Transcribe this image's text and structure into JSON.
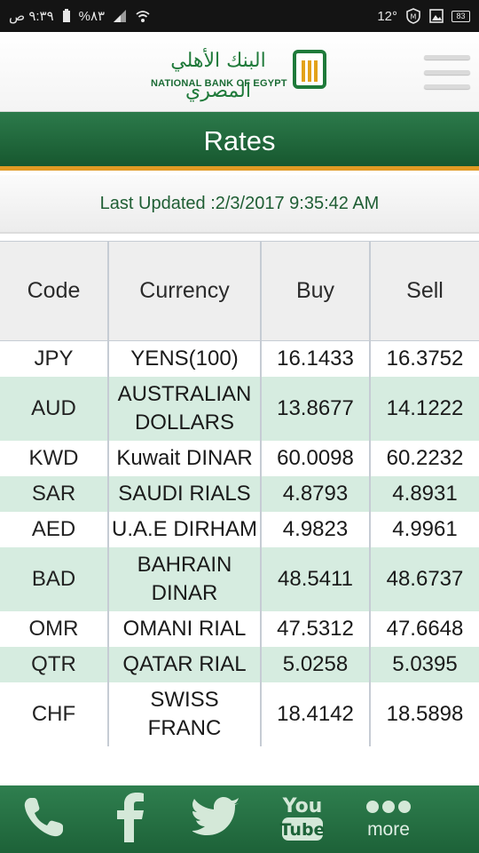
{
  "status_bar": {
    "time": "٩:٣٩ ص",
    "battery_percent": "%٨٣",
    "temperature": "12°",
    "battery_box": "83"
  },
  "header": {
    "logo_arabic": "البنك الأهلي المصري",
    "logo_english": "NATIONAL BANK OF EGYPT"
  },
  "page_title": "Rates",
  "last_updated": "Last Updated :2/3/2017 9:35:42 AM",
  "table": {
    "columns": [
      "Code",
      "Currency",
      "Buy",
      "Sell"
    ],
    "rows": [
      {
        "code": "JPY",
        "currency": "YENS(100)",
        "buy": "16.1433",
        "sell": "16.3752"
      },
      {
        "code": "AUD",
        "currency": "AUSTRALIAN DOLLARS",
        "buy": "13.8677",
        "sell": "14.1222"
      },
      {
        "code": "KWD",
        "currency": "Kuwait DINAR",
        "buy": "60.0098",
        "sell": "60.2232"
      },
      {
        "code": "SAR",
        "currency": "SAUDI RIALS",
        "buy": "4.8793",
        "sell": "4.8931"
      },
      {
        "code": "AED",
        "currency": "U.A.E DIRHAM",
        "buy": "4.9823",
        "sell": "4.9961"
      },
      {
        "code": "BAD",
        "currency": "BAHRAIN DINAR",
        "buy": "48.5411",
        "sell": "48.6737"
      },
      {
        "code": "OMR",
        "currency": "OMANI RIAL",
        "buy": "47.5312",
        "sell": "47.6648"
      },
      {
        "code": "QTR",
        "currency": "QATAR RIAL",
        "buy": "5.0258",
        "sell": "5.0395"
      },
      {
        "code": "CHF",
        "currency": "SWISS FRANC",
        "buy": "18.4142",
        "sell": "18.5898"
      }
    ]
  },
  "bottom_nav": {
    "items": [
      {
        "icon": "phone-icon"
      },
      {
        "icon": "facebook-icon"
      },
      {
        "icon": "twitter-icon"
      },
      {
        "icon": "youtube-icon",
        "top": "You",
        "bottom": "Tube"
      },
      {
        "icon": "more-icon",
        "label": "more"
      }
    ]
  },
  "colors": {
    "brand_green": "#1d6238",
    "accent_orange": "#e09a24",
    "row_alt": "#d6ece0"
  }
}
